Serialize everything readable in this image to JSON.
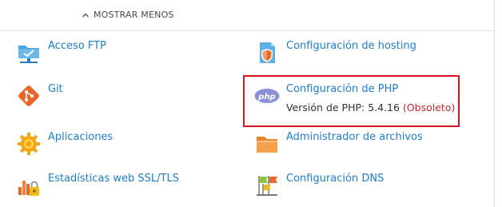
{
  "header": {
    "show_less_label": "MOSTRAR MENOS"
  },
  "items": {
    "ftp": {
      "label": "Acceso FTP",
      "icon": "ftp-folder-icon"
    },
    "hosting": {
      "label": "Configuración de hosting",
      "icon": "hosting-settings-icon"
    },
    "git": {
      "label": "Git",
      "icon": "git-icon"
    },
    "php": {
      "label": "Configuración de PHP",
      "icon": "php-icon",
      "version_prefix": "Versión de PHP: 5.4.16",
      "version_status": "(Obsoleto)"
    },
    "apps": {
      "label": "Aplicaciones",
      "icon": "gear-icon"
    },
    "files": {
      "label": "Administrador de archivos",
      "icon": "folder-icon"
    },
    "ssl": {
      "label": "Estadísticas web SSL/TLS",
      "icon": "stats-lock-icon"
    },
    "dns": {
      "label": "Configuración DNS",
      "icon": "dns-flags-icon"
    }
  },
  "colors": {
    "link": "#1e7ec8",
    "obsolete": "#c8272c",
    "highlight": "#d8151d"
  }
}
